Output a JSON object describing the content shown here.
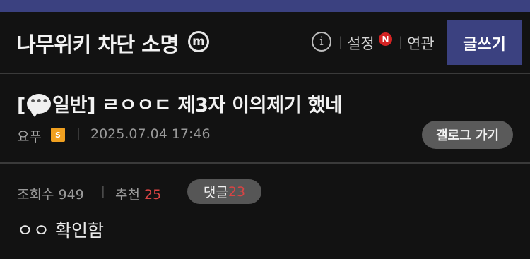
{
  "header": {
    "gallery_title": "나무위키 차단 소명",
    "minor_badge": "m",
    "info_icon": "i",
    "settings_label": "설정",
    "new_badge": "N",
    "related_label": "연관",
    "write_label": "글쓰기",
    "separator": "|"
  },
  "post": {
    "title_prefix": "[",
    "category": "일반]",
    "title_text": " ㄹㅇㅇㄷ 제3자 이의제기 했네",
    "speech_dots": "•••",
    "author": "요푸",
    "level_icon_text": "S",
    "date": "2025.07.04 17:46",
    "back_label": "갤로그 가기",
    "views_label": "조회수 949",
    "recommend_label": "추천",
    "recommend_count": "25",
    "comment_label": "댓글",
    "comment_count": "23",
    "body": "ㅇㅇ 확인함"
  },
  "colors": {
    "accent": "#3b4180",
    "background": "#121212",
    "highlight_red": "#d84444",
    "new_badge": "#d42323"
  },
  "icons": [
    "minor-gallery-icon",
    "info-icon",
    "speech-bubble-icon",
    "user-level-icon"
  ]
}
